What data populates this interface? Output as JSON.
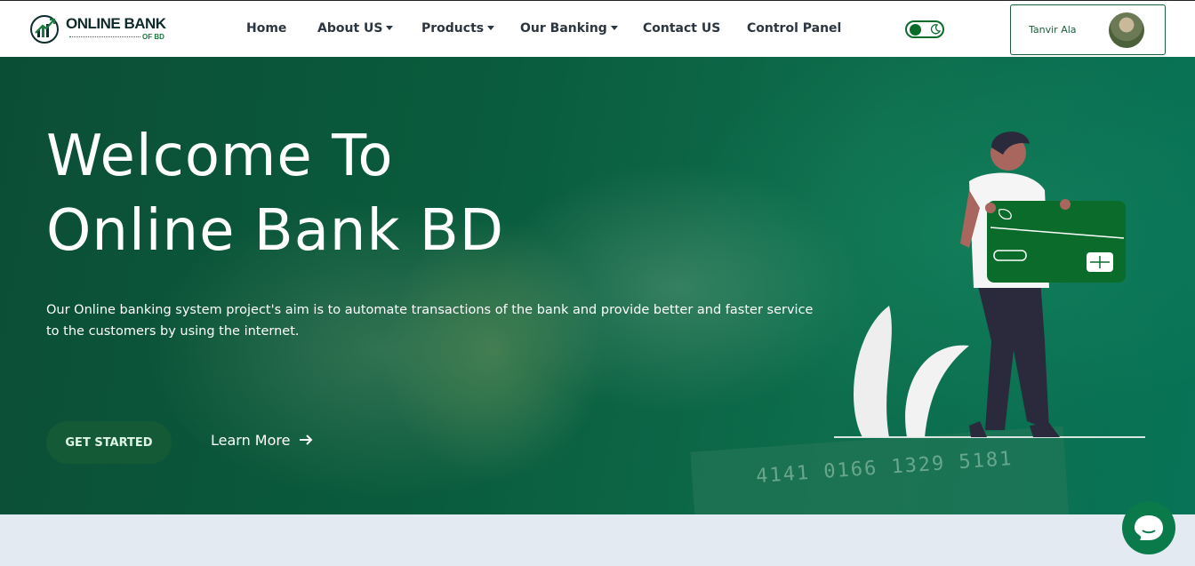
{
  "brand": {
    "name_line1": "ONLINE BANK",
    "name_line2": "OF BD"
  },
  "nav": {
    "items": [
      {
        "label": "Home",
        "dropdown": false
      },
      {
        "label": "About US",
        "dropdown": true
      },
      {
        "label": "Products",
        "dropdown": true
      },
      {
        "label": "Our Banking",
        "dropdown": true
      },
      {
        "label": "Contact US",
        "dropdown": false
      },
      {
        "label": "Control Panel",
        "dropdown": false
      }
    ],
    "theme_toggle": {
      "state": "light",
      "icon": "moon-icon"
    }
  },
  "user": {
    "name": "Tanvir Ala"
  },
  "hero": {
    "title_line1": "Welcome To",
    "title_line2": "Online Bank BD",
    "description": "Our Online banking system project's aim is to automate transactions of the bank and provide better and faster service to the customers by using the internet.",
    "cta_primary": "GET STARTED",
    "cta_secondary": "Learn More",
    "bg_card_number": "4141 0166 1329 5181"
  },
  "colors": {
    "brand_green": "#0b6b2b",
    "hero_overlay": "#0a5c3e",
    "cta_bg": "#145a36",
    "chat_bg": "#0a7a4a"
  }
}
